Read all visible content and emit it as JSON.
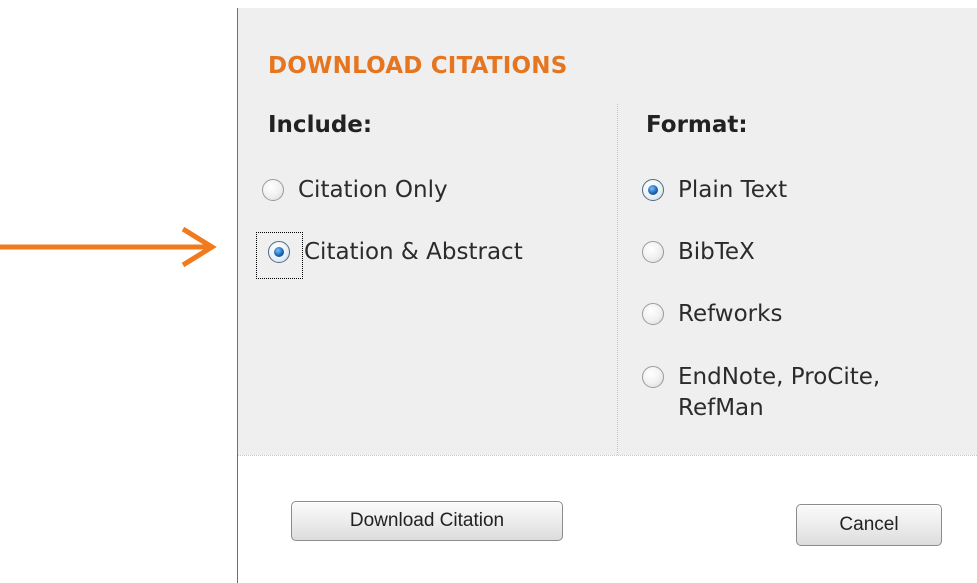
{
  "dialog": {
    "title": "DOWNLOAD CITATIONS",
    "include": {
      "heading": "Include:",
      "options": [
        {
          "label": "Citation Only",
          "checked": false
        },
        {
          "label": "Citation & Abstract",
          "checked": true
        }
      ]
    },
    "format": {
      "heading": "Format:",
      "options": [
        {
          "label": "Plain Text",
          "checked": true
        },
        {
          "label": "BibTeX",
          "checked": false
        },
        {
          "label": "Refworks",
          "checked": false
        },
        {
          "label": "EndNote, ProCite, RefMan",
          "checked": false
        }
      ]
    },
    "buttons": {
      "download": "Download Citation",
      "cancel": "Cancel"
    }
  },
  "colors": {
    "accent": "#e5751f",
    "arrow": "#f07a1c",
    "panel_bg": "#efefef"
  },
  "icons": {
    "pointer": "arrow-right-icon"
  }
}
